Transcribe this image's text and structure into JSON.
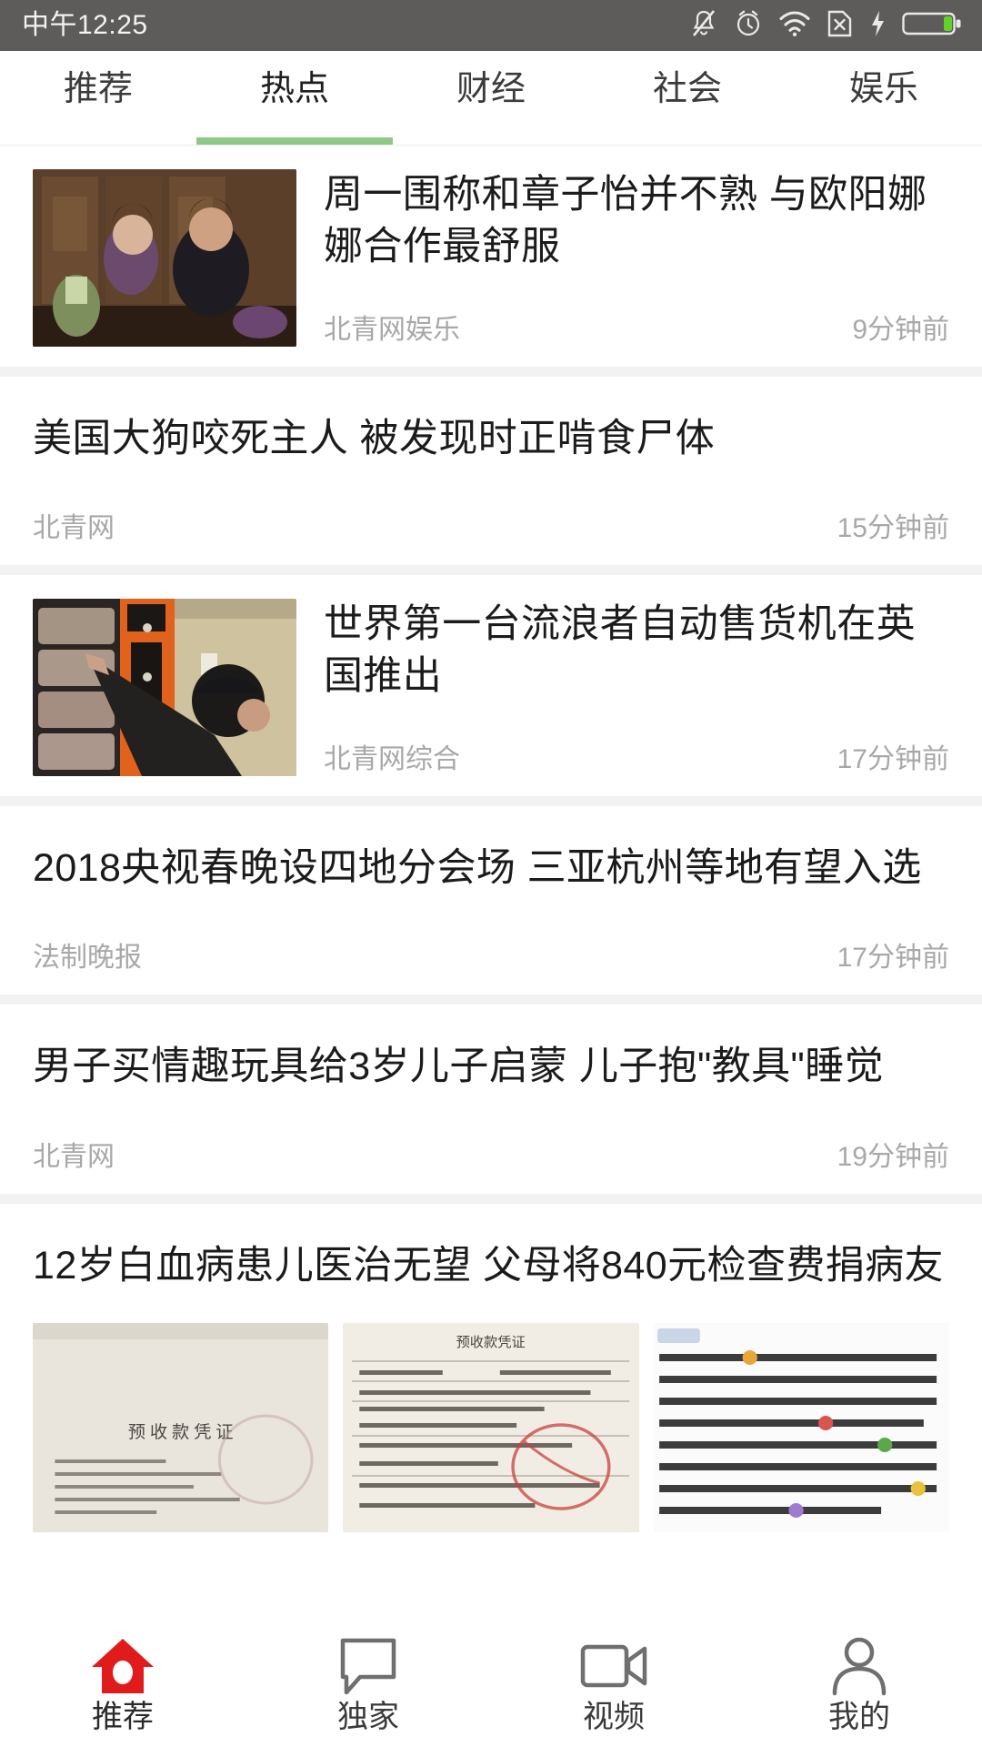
{
  "status_bar": {
    "time": "中午12:25",
    "icons": [
      "bell-muted-icon",
      "alarm-clock-icon",
      "wifi-icon",
      "sim-card-x-icon",
      "charging-bolt-icon",
      "battery-icon"
    ]
  },
  "tabs": {
    "active_index": 1,
    "accent_color": "#8fc884",
    "items": [
      {
        "label": "推荐"
      },
      {
        "label": "热点"
      },
      {
        "label": "财经"
      },
      {
        "label": "社会"
      },
      {
        "label": "娱乐"
      }
    ]
  },
  "feed": {
    "articles": [
      {
        "title": "周一围称和章子怡并不熟 与欧阳娜娜合作最舒服",
        "source": "北青网娱乐",
        "time": "9分钟前",
        "layout": "thumb-left",
        "thumb": "period-drama-couple-photo"
      },
      {
        "title": "美国大狗咬死主人 被发现时正啃食尸体",
        "source": "北青网",
        "time": "15分钟前",
        "layout": "text-only"
      },
      {
        "title": "世界第一台流浪者自动售货机在英国推出",
        "source": "北青网综合",
        "time": "17分钟前",
        "layout": "thumb-left",
        "thumb": "vending-machine-photo"
      },
      {
        "title": "2018央视春晚设四地分会场 三亚杭州等地有望入选",
        "source": "法制晚报",
        "time": "17分钟前",
        "layout": "text-only"
      },
      {
        "title": "男子买情趣玩具给3岁儿子启蒙 儿子抱\"教具\"睡觉",
        "source": "北青网",
        "time": "19分钟前",
        "layout": "text-only"
      },
      {
        "title": "12岁白血病患儿医治无望 父母将840元检查费捐病友",
        "layout": "three-thumbs",
        "thumbs": [
          "receipt-document-photo",
          "payment-voucher-photo",
          "social-post-screenshot"
        ],
        "thumb_captions": [
          "预收款凭证",
          "预收款凭证",
          ""
        ]
      }
    ]
  },
  "bottom_nav": {
    "active_index": 0,
    "active_color": "#e01b1b",
    "items": [
      {
        "label": "推荐",
        "icon": "home-icon"
      },
      {
        "label": "独家",
        "icon": "speech-bubble-icon"
      },
      {
        "label": "视频",
        "icon": "video-camera-icon"
      },
      {
        "label": "我的",
        "icon": "person-icon"
      }
    ]
  }
}
